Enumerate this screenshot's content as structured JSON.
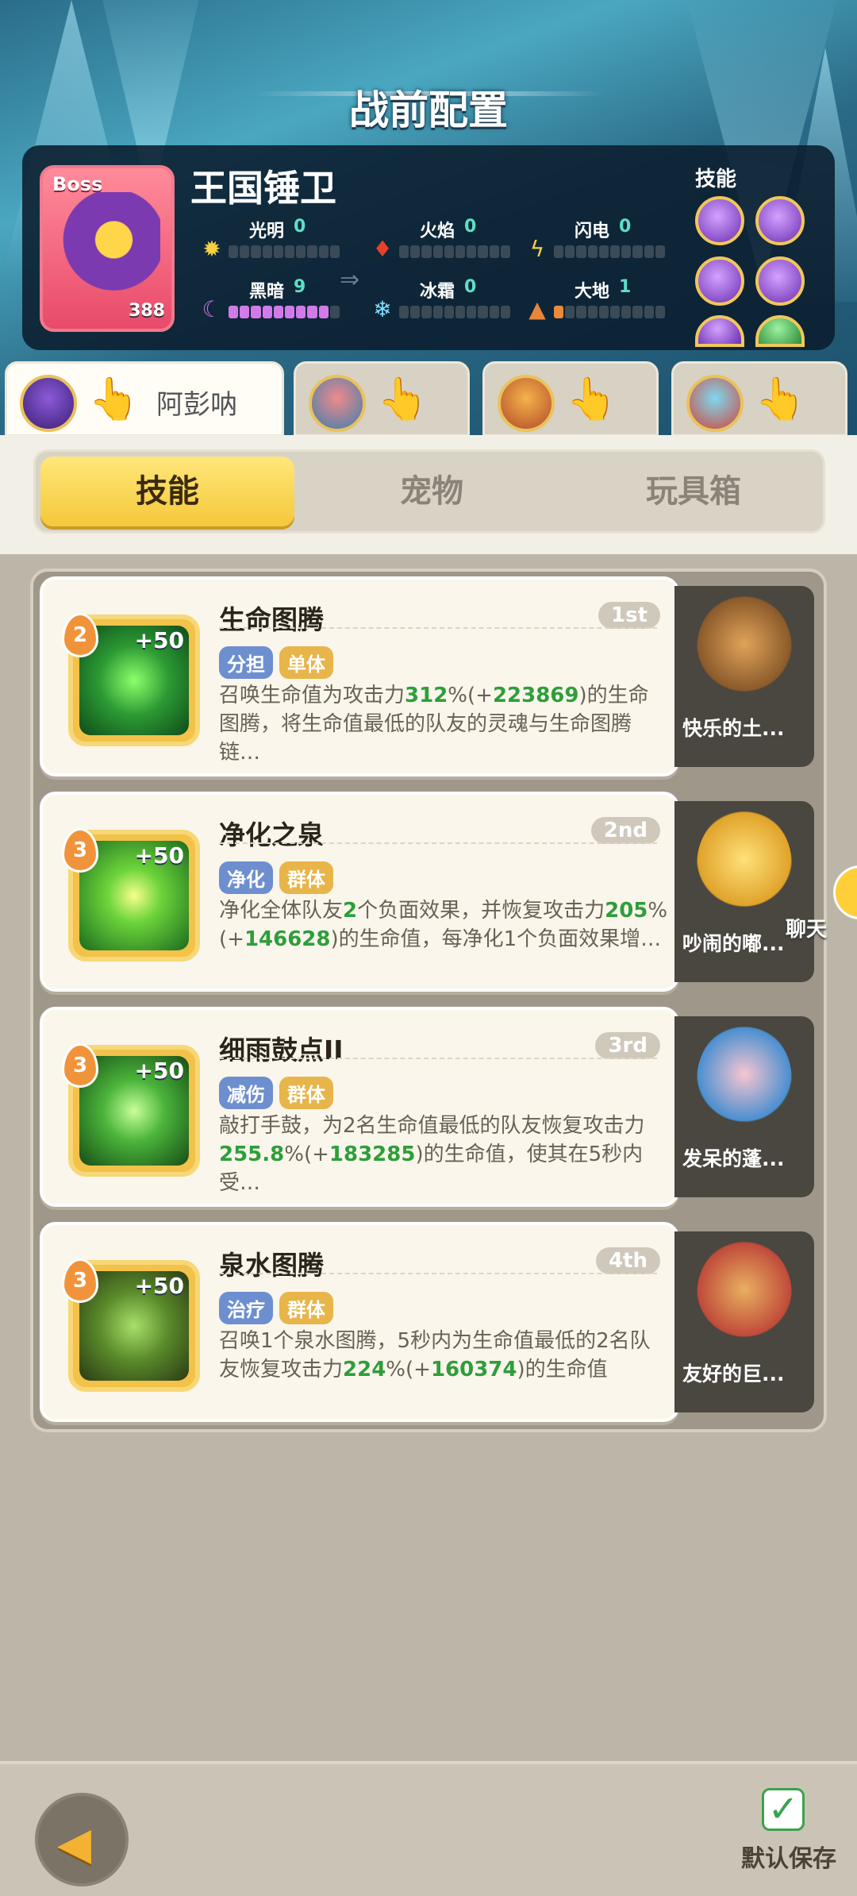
{
  "header": {
    "title": "战前配置"
  },
  "boss": {
    "tag": "Boss",
    "level": "388",
    "name": "王国锤卫",
    "skills_label": "技能",
    "elements": [
      {
        "name": "光明",
        "value": "0",
        "icon": "sun-icon"
      },
      {
        "name": "火焰",
        "value": "0",
        "icon": "flame-icon"
      },
      {
        "name": "闪电",
        "value": "0",
        "icon": "lightning-icon"
      },
      {
        "name": "黑暗",
        "value": "9",
        "icon": "moon-icon"
      },
      {
        "name": "冰霜",
        "value": "0",
        "icon": "snowflake-icon"
      },
      {
        "name": "大地",
        "value": "1",
        "icon": "mountain-icon"
      }
    ]
  },
  "heroes": [
    {
      "name": "阿彭呐",
      "active": true
    },
    {
      "name": "",
      "active": false
    },
    {
      "name": "",
      "active": false
    },
    {
      "name": "",
      "active": false
    }
  ],
  "tabs": [
    "技能",
    "宠物",
    "玩具箱"
  ],
  "skills": [
    {
      "level": "2",
      "bonus": "+50",
      "name": "生命图腾",
      "rank": "1st",
      "tags": [
        "分担",
        "单体"
      ],
      "desc": [
        "召唤生命值为攻击力",
        "312",
        "%(+",
        "223869",
        ")的生命图腾，将生命值最低的队友的灵魂与生命图腾链…"
      ],
      "pet": "快乐的土..."
    },
    {
      "level": "3",
      "bonus": "+50",
      "name": "净化之泉",
      "rank": "2nd",
      "tags": [
        "净化",
        "群体"
      ],
      "desc": [
        "净化全体队友",
        "2",
        "个负面效果，并恢复攻击力",
        "205",
        "%(+",
        "146628",
        ")的生命值，每净化1个负面效果增…"
      ],
      "pet": "吵闹的嘟..."
    },
    {
      "level": "3",
      "bonus": "+50",
      "name": "细雨鼓点II",
      "rank": "3rd",
      "tags": [
        "减伤",
        "群体"
      ],
      "desc": [
        "敲打手鼓，为2名生命值最低的队友恢复攻击力",
        "255.8",
        "%(+",
        "183285",
        ")的生命值，使其在5秒内受…"
      ],
      "pet": "发呆的蓬..."
    },
    {
      "level": "3",
      "bonus": "+50",
      "name": "泉水图腾",
      "rank": "4th",
      "tags": [
        "治疗",
        "群体"
      ],
      "desc": [
        "召唤1个泉水图腾，5秒内为生命值最低的2名队友恢复攻击力",
        "224",
        "%(+",
        "160374",
        ")的生命值"
      ],
      "pet": "友好的巨..."
    }
  ],
  "chat": {
    "label": "聊天"
  },
  "footer": {
    "save_label": "默认保存"
  }
}
